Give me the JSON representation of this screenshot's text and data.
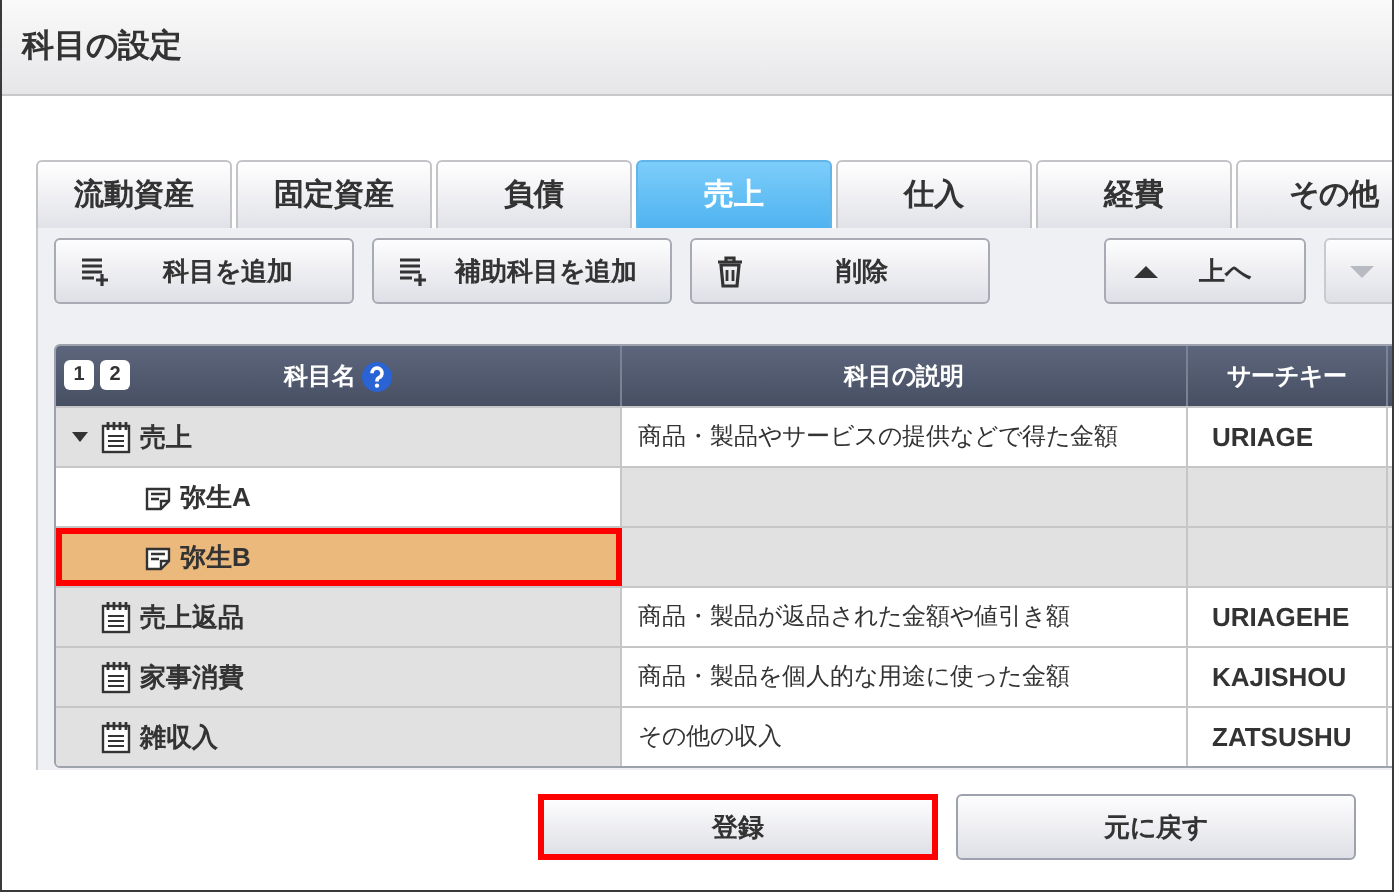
{
  "window": {
    "title": "科目の設定"
  },
  "tabs": [
    {
      "label": "流動資産",
      "selected": false
    },
    {
      "label": "固定資産",
      "selected": false
    },
    {
      "label": "負債",
      "selected": false
    },
    {
      "label": "売上",
      "selected": true
    },
    {
      "label": "仕入",
      "selected": false
    },
    {
      "label": "経費",
      "selected": false
    },
    {
      "label": "その他",
      "selected": false
    }
  ],
  "toolbar": [
    {
      "kind": "add",
      "label": "科目を追加",
      "disabled": false
    },
    {
      "kind": "add",
      "label": "補助科目を追加",
      "disabled": false
    },
    {
      "kind": "delete",
      "label": "削除",
      "disabled": false
    },
    {
      "kind": "up",
      "label": "上へ",
      "disabled": false
    },
    {
      "kind": "down",
      "disabled": true
    }
  ],
  "table": {
    "level_buttons": [
      "1",
      "2"
    ],
    "columns": [
      "科目名",
      "科目の説明",
      "サーチキー"
    ],
    "rows": [
      {
        "name": "売上",
        "description": "商品・製品やサービスの提供などで得た金額",
        "search_key": "URIAGE",
        "expanded": true,
        "selected": false,
        "highlighted": false,
        "children": [
          {
            "name": "弥生A",
            "selected": false,
            "highlighted": false
          },
          {
            "name": "弥生B",
            "selected": true,
            "highlighted": true
          }
        ]
      },
      {
        "name": "売上返品",
        "description": "商品・製品が返品された金額や値引き額",
        "search_key": "URIAGEHE",
        "selected": false,
        "highlighted": false
      },
      {
        "name": "家事消費",
        "description": "商品・製品を個人的な用途に使った金額",
        "search_key": "KAJISHOU",
        "selected": false,
        "highlighted": false
      },
      {
        "name": "雑収入",
        "description": "その他の収入",
        "search_key": "ZATSUSHU",
        "selected": false,
        "highlighted": false
      }
    ]
  },
  "buttons": [
    {
      "label": "登録",
      "highlighted": true
    },
    {
      "label": "元に戻す",
      "highlighted": false
    }
  ]
}
